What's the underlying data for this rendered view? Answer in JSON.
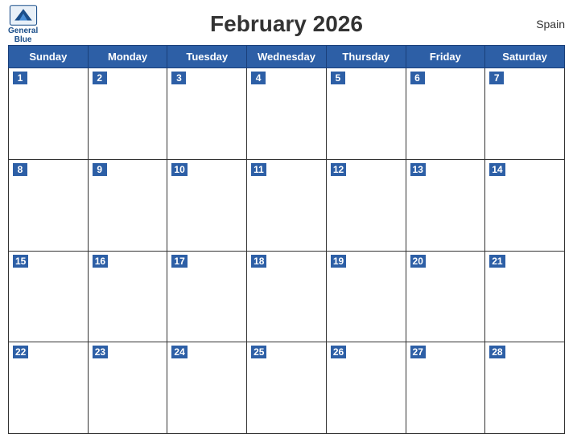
{
  "header": {
    "title": "February 2026",
    "country": "Spain",
    "logo_line1": "General",
    "logo_line2": "Blue"
  },
  "days_of_week": [
    "Sunday",
    "Monday",
    "Tuesday",
    "Wednesday",
    "Thursday",
    "Friday",
    "Saturday"
  ],
  "weeks": [
    [
      1,
      2,
      3,
      4,
      5,
      6,
      7
    ],
    [
      8,
      9,
      10,
      11,
      12,
      13,
      14
    ],
    [
      15,
      16,
      17,
      18,
      19,
      20,
      21
    ],
    [
      22,
      23,
      24,
      25,
      26,
      27,
      28
    ]
  ],
  "colors": {
    "header_bg": "#2d5fa6",
    "logo_color": "#1a4e8a"
  }
}
